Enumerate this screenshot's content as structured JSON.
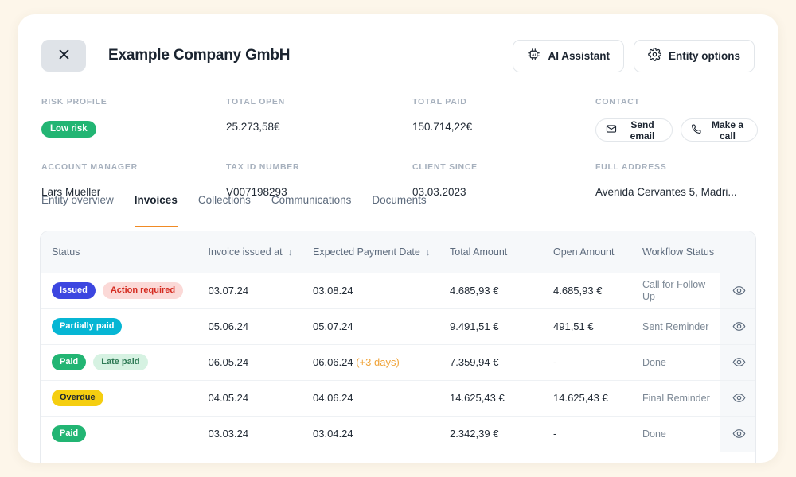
{
  "theme": {
    "page_bg": "#FDF6EA",
    "accent": "#F08A24",
    "card_bg": "#FFFFFF"
  },
  "header": {
    "close_icon": "close-icon",
    "title": "Example Company GmbH",
    "ai_assistant_label": "AI Assistant",
    "ai_assistant_icon": "chip-ai-icon",
    "entity_options_label": "Entity options",
    "entity_options_icon": "gear-icon"
  },
  "meta": {
    "risk_profile_label": "RISK PROFILE",
    "risk_profile_value": "Low risk",
    "risk_profile_color": "#22B573",
    "total_open_label": "TOTAL OPEN",
    "total_open_value": "25.273,58€",
    "total_paid_label": "TOTAL PAID",
    "total_paid_value": "150.714,22€",
    "contact_label": "CONTACT",
    "send_email_label": "Send email",
    "send_email_icon": "envelope-icon",
    "make_call_label": "Make a call",
    "make_call_icon": "phone-icon",
    "account_manager_label": "ACCOUNT MANAGER",
    "account_manager_value": "Lars Mueller",
    "tax_id_label": "TAX ID NUMBER",
    "tax_id_value": "V007198293",
    "client_since_label": "CLIENT SINCE",
    "client_since_value": "03.03.2023",
    "full_address_label": "FULL ADDRESS",
    "full_address_value": "Avenida Cervantes 5, Madri..."
  },
  "tabs": [
    {
      "label": "Entity overview",
      "active": false
    },
    {
      "label": "Invoices",
      "active": true
    },
    {
      "label": "Collections",
      "active": false
    },
    {
      "label": "Communications",
      "active": false
    },
    {
      "label": "Documents",
      "active": false
    }
  ],
  "table": {
    "columns": [
      {
        "label": "Status",
        "sort": ""
      },
      {
        "label": "Invoice issued at",
        "sort": "↓"
      },
      {
        "label": "Expected Payment Date",
        "sort": "↓"
      },
      {
        "label": "Total Amount",
        "sort": ""
      },
      {
        "label": "Open Amount",
        "sort": ""
      },
      {
        "label": "Workflow Status",
        "sort": ""
      },
      {
        "label": "",
        "sort": ""
      }
    ],
    "view_icon": "eye-icon",
    "rows": [
      {
        "badges": [
          {
            "text": "Issued",
            "bg": "#3C46E0",
            "fg": "#FFFFFF"
          },
          {
            "text": "Action required",
            "bg": "#FBD9D7",
            "fg": "#D42B20"
          }
        ],
        "issued_at": "03.07.24",
        "expected_date": "03.08.24",
        "expected_late": "",
        "total_amount": "4.685,93 €",
        "open_amount": "4.685,93 €",
        "workflow_status": "Call for Follow Up"
      },
      {
        "badges": [
          {
            "text": "Partially paid",
            "bg": "#06B6D4",
            "fg": "#FFFFFF"
          }
        ],
        "issued_at": "05.06.24",
        "expected_date": "05.07.24",
        "expected_late": "",
        "total_amount": "9.491,51 €",
        "open_amount": "491,51 €",
        "workflow_status": "Sent Reminder"
      },
      {
        "badges": [
          {
            "text": "Paid",
            "bg": "#22B573",
            "fg": "#FFFFFF"
          },
          {
            "text": "Late paid",
            "bg": "#D6F2E2",
            "fg": "#2E7A55"
          }
        ],
        "issued_at": "06.05.24",
        "expected_date": "06.06.24",
        "expected_late": "(+3 days)",
        "total_amount": "7.359,94 €",
        "open_amount": "-",
        "workflow_status": "Done"
      },
      {
        "badges": [
          {
            "text": "Overdue",
            "bg": "#F5CE10",
            "fg": "#1B2430"
          }
        ],
        "issued_at": "04.05.24",
        "expected_date": "04.06.24",
        "expected_late": "",
        "total_amount": "14.625,43 €",
        "open_amount": "14.625,43 €",
        "workflow_status": "Final Reminder"
      },
      {
        "badges": [
          {
            "text": "Paid",
            "bg": "#22B573",
            "fg": "#FFFFFF"
          }
        ],
        "issued_at": "03.03.24",
        "expected_date": "03.04.24",
        "expected_late": "",
        "total_amount": "2.342,39 €",
        "open_amount": "-",
        "workflow_status": "Done"
      }
    ]
  }
}
